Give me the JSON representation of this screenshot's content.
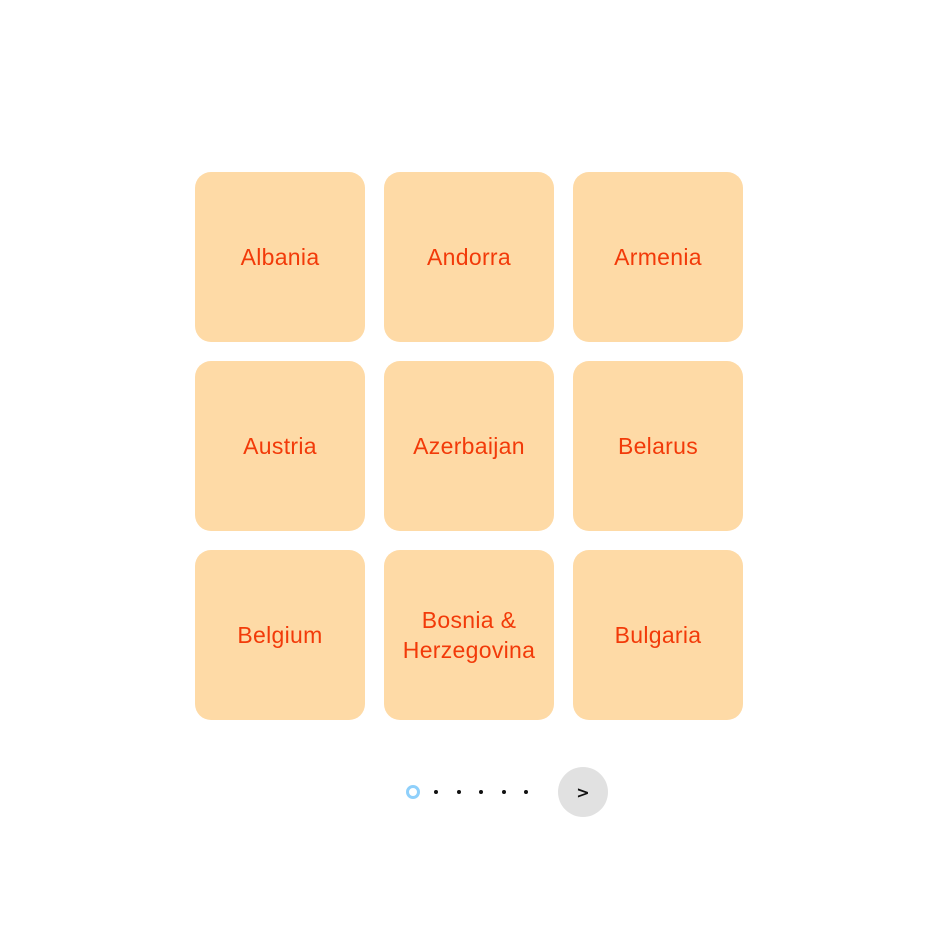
{
  "colors": {
    "tile_background": "#fedaa6",
    "tile_text": "#f23a09",
    "active_dot": "#8fd0fb",
    "next_button_background": "#e1e1e1"
  },
  "grid": {
    "tiles": [
      {
        "label": "Albania"
      },
      {
        "label": "Andorra"
      },
      {
        "label": "Armenia"
      },
      {
        "label": "Austria"
      },
      {
        "label": "Azerbaijan"
      },
      {
        "label": "Belarus"
      },
      {
        "label": "Belgium"
      },
      {
        "label": "Bosnia & Herzegovina"
      },
      {
        "label": "Bulgaria"
      }
    ]
  },
  "pagination": {
    "page_count": 6,
    "current_page": 1,
    "next_label": ">"
  }
}
